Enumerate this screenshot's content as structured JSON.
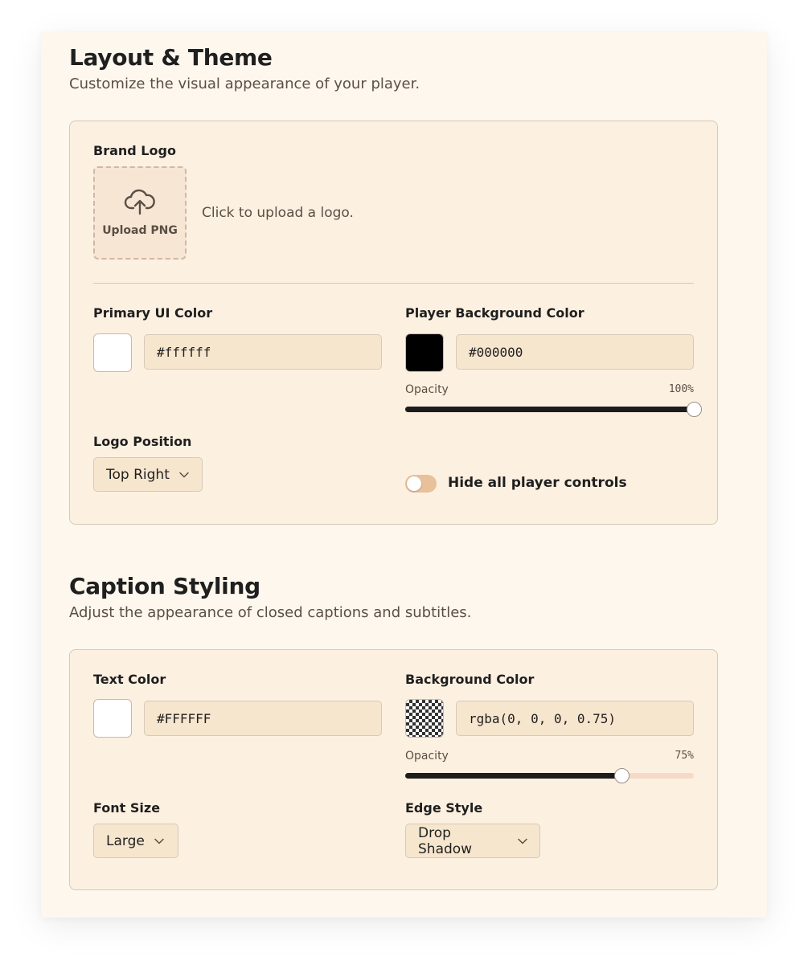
{
  "layout_theme": {
    "title": "Layout & Theme",
    "subtitle": "Customize the visual appearance of your player.",
    "brand_logo": {
      "label": "Brand Logo",
      "upload_button": "Upload PNG",
      "upload_icon": "cloud-upload-icon",
      "hint": "Click to upload a logo."
    },
    "primary_ui_color": {
      "label": "Primary UI Color",
      "value": "#ffffff",
      "swatch": "#ffffff"
    },
    "player_background_color": {
      "label": "Player Background Color",
      "value": "#000000",
      "swatch": "#000000",
      "opacity_label": "Opacity",
      "opacity_text": "100%",
      "opacity": 1.0
    },
    "logo_position": {
      "label": "Logo Position",
      "selected": "Top Right"
    },
    "hide_controls": {
      "label": "Hide all player controls",
      "checked": false
    }
  },
  "caption_styling": {
    "title": "Caption Styling",
    "subtitle": "Adjust the appearance of closed captions and subtitles.",
    "text_color": {
      "label": "Text Color",
      "value": "#FFFFFF",
      "swatch": "#ffffff"
    },
    "background_color": {
      "label": "Background Color",
      "value": "rgba(0, 0, 0, 0.75)",
      "opacity_label": "Opacity",
      "opacity_text": "75%",
      "opacity": 0.75
    },
    "font_size": {
      "label": "Font Size",
      "selected": "Large"
    },
    "edge_style": {
      "label": "Edge Style",
      "selected": "Drop Shadow"
    }
  },
  "colors": {
    "panel_bg": "#fdf7ee",
    "card_bg": "#fcf0e1",
    "slider_fill": "#1c1c1c",
    "slider_track": "#f6d9c6",
    "toggle_off": "#e8c09a"
  }
}
